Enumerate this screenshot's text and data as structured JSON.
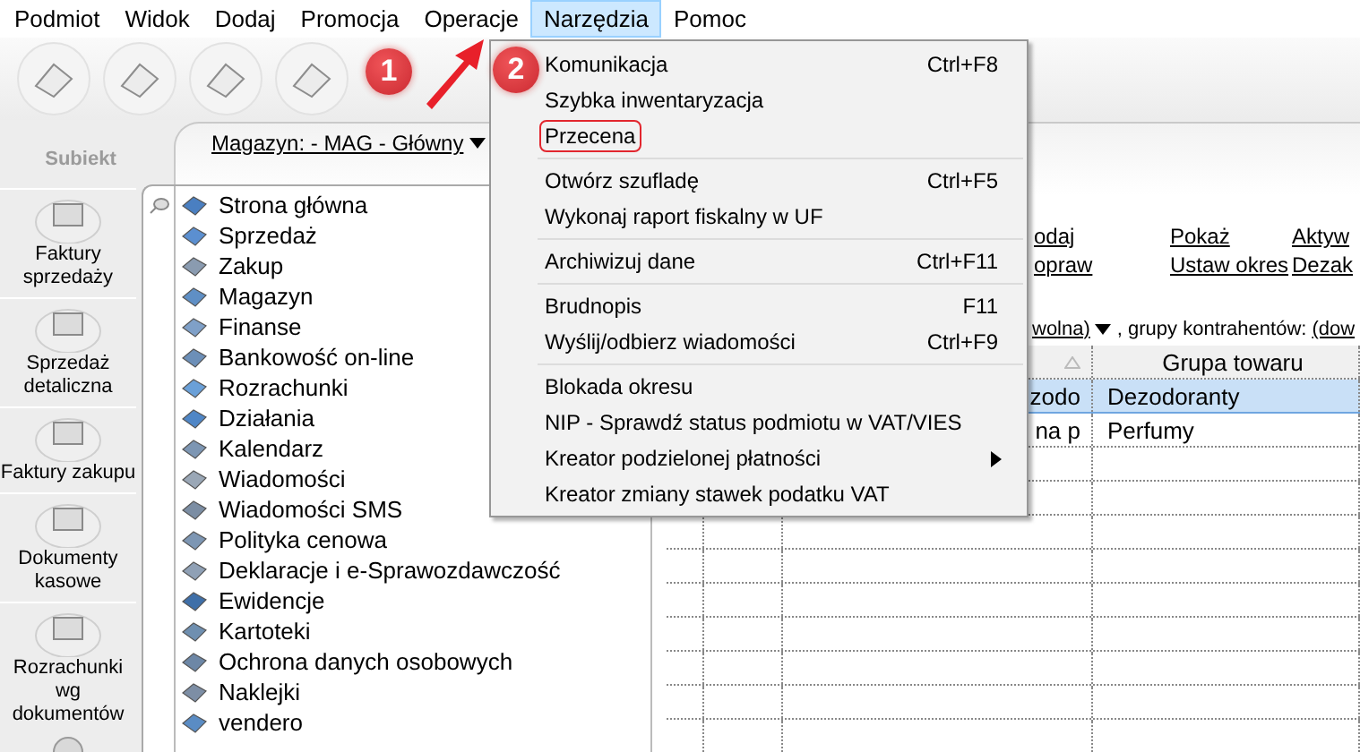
{
  "menubar": [
    {
      "label": "Podmiot",
      "selected": false
    },
    {
      "label": "Widok",
      "selected": false
    },
    {
      "label": "Dodaj",
      "selected": false
    },
    {
      "label": "Promocja",
      "selected": false
    },
    {
      "label": "Operacje",
      "selected": false
    },
    {
      "label": "Narzędzia",
      "selected": true
    },
    {
      "label": "Pomoc",
      "selected": false
    }
  ],
  "sidebar": {
    "logo": "Subiekt",
    "tiles": [
      {
        "label": "Faktury sprzedaży"
      },
      {
        "label": "Sprzedaż detaliczna"
      },
      {
        "label": "Faktury zakupu"
      },
      {
        "label": "Dokumenty kasowe"
      },
      {
        "label": "Rozrachunki wg dokumentów"
      }
    ]
  },
  "panel": {
    "warehouse": "Magazyn: - MAG - Główny",
    "link_columns": [
      [
        "odaj",
        "opraw"
      ],
      [
        "Pokaż",
        "Ustaw okres"
      ],
      [
        "Aktyw",
        "Dezak"
      ]
    ],
    "filter": {
      "value": "wolna)",
      "label": ", grupy kontrahentów:",
      "value_2": "(dow"
    },
    "table": {
      "column_4": "Grupa towaru",
      "rows": [
        {
          "selected": true,
          "cells": [
            "zodo",
            "Dezodoranty"
          ]
        },
        {
          "selected": false,
          "cells": [
            "na p",
            "Perfumy"
          ]
        }
      ]
    }
  },
  "nav": {
    "items": [
      "Strona główna",
      "Sprzedaż",
      "Zakup",
      "Magazyn",
      "Finanse",
      "Bankowość on-line",
      "Rozrachunki",
      "Działania",
      "Kalendarz",
      "Wiadomości",
      "Wiadomości SMS",
      "Polityka cenowa",
      "Deklaracje i e-Sprawozdawczość",
      "Ewidencje",
      "Kartoteki",
      "Ochrona danych osobowych",
      "Naklejki",
      "vendero"
    ]
  },
  "dropdown": {
    "items": [
      {
        "label": "Komunikacja",
        "shortcut": "Ctrl+F8",
        "highlighted": false,
        "separator_after": false
      },
      {
        "label": "Szybka inwentaryzacja",
        "highlighted": false,
        "separator_after": false
      },
      {
        "label": "Przecena",
        "highlighted": true,
        "separator_after": true
      },
      {
        "label": "Otwórz szufladę",
        "shortcut": "Ctrl+F5",
        "highlighted": false,
        "separator_after": false
      },
      {
        "label": "Wykonaj raport fiskalny w UF",
        "highlighted": false,
        "separator_after": true
      },
      {
        "label": "Archiwizuj dane",
        "shortcut": "Ctrl+F11",
        "highlighted": false,
        "separator_after": true
      },
      {
        "label": "Brudnopis",
        "shortcut": "F11",
        "highlighted": false,
        "separator_after": false
      },
      {
        "label": "Wyślij/odbierz wiadomości",
        "shortcut": "Ctrl+F9",
        "highlighted": false,
        "separator_after": true
      },
      {
        "label": "Blokada okresu",
        "highlighted": false,
        "separator_after": false
      },
      {
        "label": "NIP - Sprawdź status podmiotu w VAT/VIES",
        "highlighted": false,
        "separator_after": false
      },
      {
        "label": "Kreator podzielonej płatności",
        "submenu": true,
        "highlighted": false,
        "separator_after": false
      },
      {
        "label": "Kreator zmiany stawek podatku VAT",
        "highlighted": false,
        "separator_after": false
      }
    ]
  },
  "annotations": [
    {
      "label": "1"
    },
    {
      "label": "2"
    }
  ]
}
